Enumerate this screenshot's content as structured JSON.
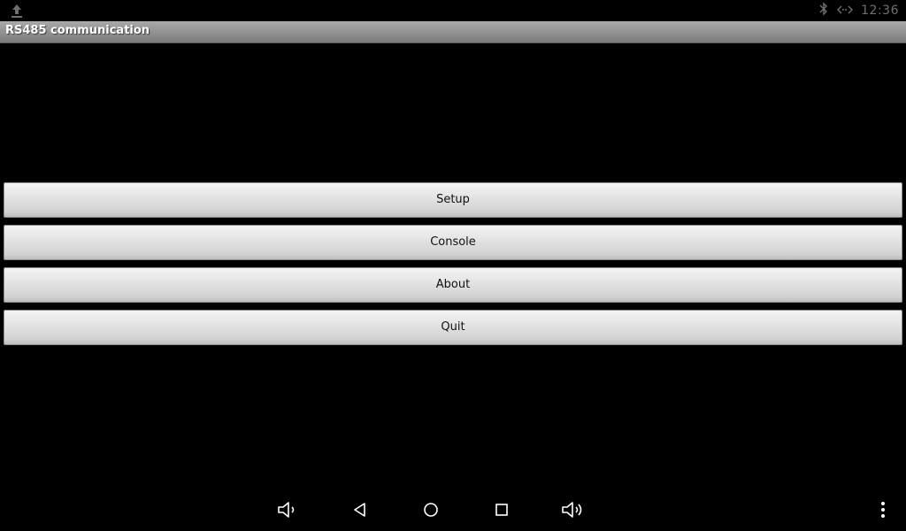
{
  "status_bar": {
    "time": "12:36",
    "left_icon": "upload-icon",
    "right_icons": [
      "bluetooth-icon",
      "data-sync-icon"
    ]
  },
  "app": {
    "title": "RS485 communication"
  },
  "menu": {
    "items": [
      {
        "label": "Setup"
      },
      {
        "label": "Console"
      },
      {
        "label": "About"
      },
      {
        "label": "Quit"
      }
    ]
  },
  "nav_bar": {
    "icons": [
      "volume-down-icon",
      "back-icon",
      "home-icon",
      "recents-icon",
      "volume-up-icon",
      "overflow-menu-icon"
    ]
  },
  "colors": {
    "background": "#000000",
    "title_bar": "#909090",
    "button": "#e0e0e0",
    "status_icons": "#6f6f6f",
    "nav_icons": "#ffffff"
  }
}
